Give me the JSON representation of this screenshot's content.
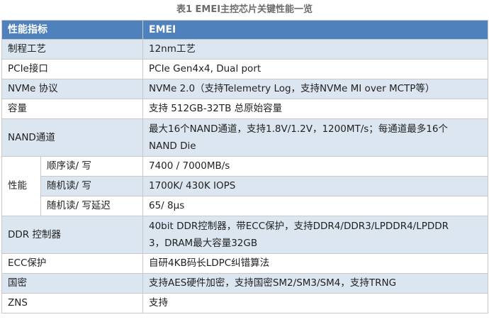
{
  "caption": "表1 EMEI主控芯片关键性能一览",
  "header": {
    "col1": "性能指标",
    "col2": "EMEI"
  },
  "rows": {
    "process": {
      "label": "制程工艺",
      "value": "12nm工艺"
    },
    "pcie": {
      "label": "PCIe接口",
      "value": "PCIe Gen4x4, Dual port"
    },
    "nvme": {
      "label": "NVMe 协议",
      "value": "NVMe 2.0（支持Telemetry  Log，支持NVMe MI over MCTP等）"
    },
    "capacity": {
      "label": "容量",
      "value": "支持 512GB-32TB 总原始容量"
    },
    "nand": {
      "label": "NAND通道",
      "value_line1": "最大16个NAND通道，支持1.8V/1.2V，1200MT/s；每通道最多16个",
      "value_line2": "NAND  Die"
    },
    "perf": {
      "label": "性能",
      "seq": {
        "label": "顺序读/ 写",
        "value": "7400 / 7000MB/s"
      },
      "rand": {
        "label": "随机读/ 写",
        "value": "1700K/ 430K IOPS"
      },
      "latency": {
        "label": "随机读/ 写延迟",
        "value": "65/ 8μs"
      }
    },
    "ddr": {
      "label": "DDR 控制器",
      "value_line1": "40bit DDR控制器，带ECC保护，支持DDR4/DDR3/LPDDR4/LPDDR",
      "value_line2": "3，DRAM最大容量32GB"
    },
    "ecc": {
      "label": "ECC保护",
      "value": "自研4KB码长LDPC纠错算法"
    },
    "crypto": {
      "label": "国密",
      "value": "支持AES硬件加密，支持国密SM2/SM3/SM4，支持TRNG"
    },
    "zns": {
      "label": "ZNS",
      "value": "支持"
    }
  }
}
